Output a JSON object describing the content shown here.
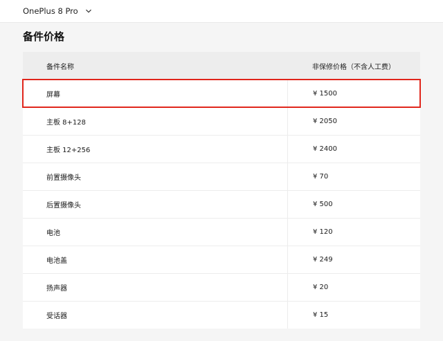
{
  "header": {
    "model": "OnePlus 8 Pro",
    "chevron_icon": "chevron-down-icon"
  },
  "section": {
    "title": "备件价格"
  },
  "table": {
    "columns": [
      "备件名称",
      "非保修价格（不含人工费）"
    ],
    "rows": [
      {
        "part": "屏幕",
        "price": "¥ 1500",
        "highlighted": true
      },
      {
        "part": "主板 8+128",
        "price": "¥ 2050"
      },
      {
        "part": "主板 12+256",
        "price": "¥ 2400"
      },
      {
        "part": "前置摄像头",
        "price": "¥ 70"
      },
      {
        "part": "后置摄像头",
        "price": "¥ 500"
      },
      {
        "part": "电池",
        "price": "¥ 120"
      },
      {
        "part": "电池盖",
        "price": "¥ 249"
      },
      {
        "part": "扬声器",
        "price": "¥ 20"
      },
      {
        "part": "受话器",
        "price": "¥ 15"
      }
    ]
  },
  "colors": {
    "highlight_border": "#e0251b",
    "header_bg": "#ededed"
  }
}
